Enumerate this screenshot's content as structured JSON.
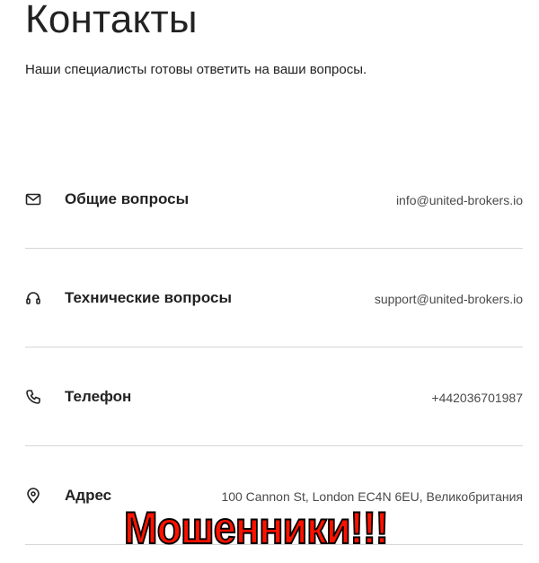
{
  "header": {
    "title": "Контакты",
    "subtitle": "Наши специалисты готовы ответить на ваши вопросы."
  },
  "contacts": [
    {
      "icon": "mail-icon",
      "label": "Общие вопросы",
      "value": "info@united-brokers.io"
    },
    {
      "icon": "headset-icon",
      "label": "Технические вопросы",
      "value": "support@united-brokers.io"
    },
    {
      "icon": "phone-icon",
      "label": "Телефон",
      "value": "+442036701987"
    },
    {
      "icon": "location-pin-icon",
      "label": "Адрес",
      "value": "100 Cannon St, London EC4N 6EU, Великобритания"
    }
  ],
  "overlay": {
    "text": "Мошенники!!!",
    "color": "#ff1100",
    "outline_color": "#000000"
  }
}
